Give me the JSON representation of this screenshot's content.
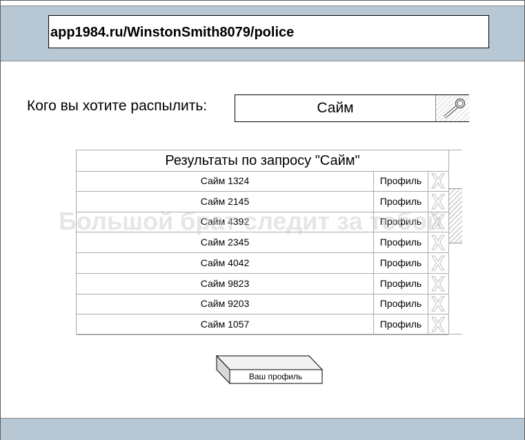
{
  "browser": {
    "url": "app1984.ru/WinstonSmith8079/police"
  },
  "search": {
    "prompt": "Кого вы хотите распылить:",
    "value": "Сайм",
    "button_icon": "magnifier-icon"
  },
  "results": {
    "title": "Результаты по запросу \"Сайм\"",
    "rows": [
      {
        "name": "Сайм 1324",
        "profile": "Профиль"
      },
      {
        "name": "Сайм 2145",
        "profile": "Профиль"
      },
      {
        "name": "Сайм 4392",
        "profile": "Профиль"
      },
      {
        "name": "Сайм 2345",
        "profile": "Профиль"
      },
      {
        "name": "Сайм 4042",
        "profile": "Профиль"
      },
      {
        "name": "Сайм 9823",
        "profile": "Профиль"
      },
      {
        "name": "Сайм 9203",
        "profile": "Профиль"
      },
      {
        "name": "Сайм 1057",
        "profile": "Профиль"
      }
    ],
    "delete_icon": "x-delete-icon"
  },
  "watermark": "Большой брат следит за тобой",
  "footer": {
    "my_profile_label": "Ваш профиль"
  },
  "colors": {
    "bar": "#b8c7d4",
    "border": "#aaaaaa"
  }
}
